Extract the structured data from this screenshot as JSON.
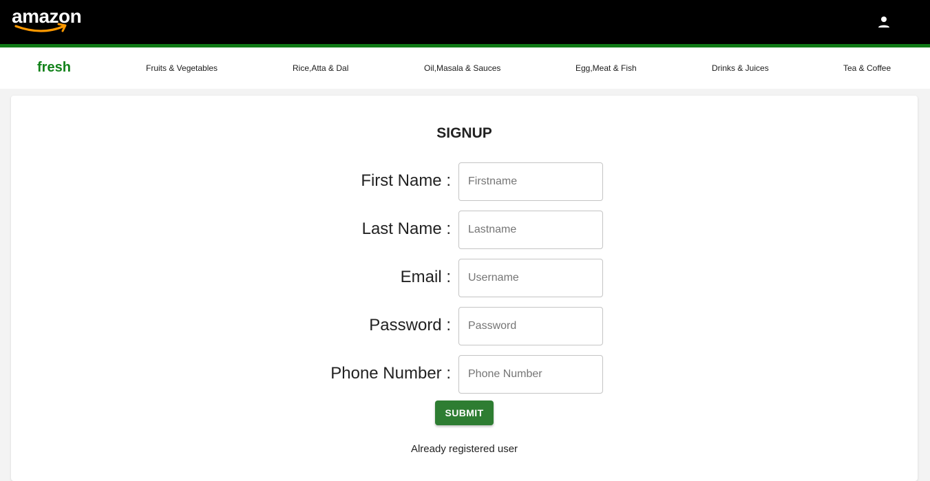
{
  "header": {
    "logo_text": "amazon",
    "account_icon": "account-person-icon"
  },
  "nav": {
    "brand": "fresh",
    "links": [
      "Fruits & Vegetables",
      "Rice,Atta & Dal",
      "Oil,Masala & Sauces",
      "Egg,Meat & Fish",
      "Drinks & Juices",
      "Tea & Coffee"
    ]
  },
  "form": {
    "title": "SIGNUP",
    "fields": [
      {
        "label": "First Name :",
        "placeholder": "Firstname",
        "value": ""
      },
      {
        "label": "Last Name :",
        "placeholder": "Lastname",
        "value": ""
      },
      {
        "label": "Email :",
        "placeholder": "Username",
        "value": ""
      },
      {
        "label": "Password :",
        "placeholder": "Password",
        "value": ""
      },
      {
        "label": "Phone Number :",
        "placeholder": "Phone Number",
        "value": ""
      }
    ],
    "submit_label": "SUBMIT",
    "already_registered": "Already registered user"
  },
  "colors": {
    "header_bg": "#000000",
    "accent_green": "#0f7a16",
    "button_green": "#2e7d32",
    "logo_smile": "#ff9900"
  }
}
